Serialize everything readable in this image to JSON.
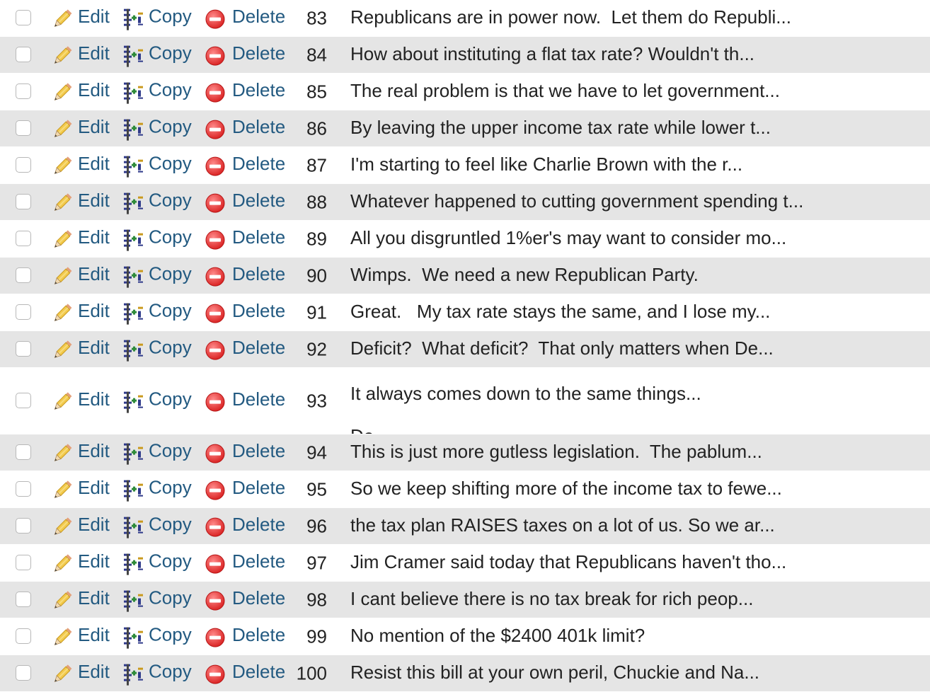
{
  "actions": {
    "edit": "Edit",
    "copy": "Copy",
    "delete": "Delete"
  },
  "rows": [
    {
      "id": "83",
      "text": "Republicans are in power now.  Let them do Republi..."
    },
    {
      "id": "84",
      "text": "How about instituting a flat tax rate? Wouldn't th..."
    },
    {
      "id": "85",
      "text": "The real problem is that we have to let government..."
    },
    {
      "id": "86",
      "text": "By leaving the upper income tax rate while lower t..."
    },
    {
      "id": "87",
      "text": "I'm starting to feel like Charlie Brown with the r..."
    },
    {
      "id": "88",
      "text": "Whatever happened to cutting government spending t..."
    },
    {
      "id": "89",
      "text": "All you disgruntled 1%er's may want to consider mo..."
    },
    {
      "id": "90",
      "text": "Wimps.  We need a new Republican Party."
    },
    {
      "id": "91",
      "text": "Great.   My tax rate stays the same, and I lose my..."
    },
    {
      "id": "92",
      "text": "Deficit?  What deficit?  That only matters when De..."
    },
    {
      "id": "93",
      "text": "It always comes down to the same things...",
      "text2": "De..."
    },
    {
      "id": "94",
      "text": "This is just more gutless legislation.  The pablum..."
    },
    {
      "id": "95",
      "text": "So we keep shifting more of the income tax to fewe..."
    },
    {
      "id": "96",
      "text": "the tax plan RAISES taxes on a lot of us. So we ar..."
    },
    {
      "id": "97",
      "text": "Jim Cramer said today that Republicans haven't tho..."
    },
    {
      "id": "98",
      "text": "I cant believe there is no tax break for rich peop..."
    },
    {
      "id": "99",
      "text": "No mention of the $2400 401k limit?"
    },
    {
      "id": "100",
      "text": "Resist this bill at your own peril, Chuckie and Na..."
    }
  ]
}
